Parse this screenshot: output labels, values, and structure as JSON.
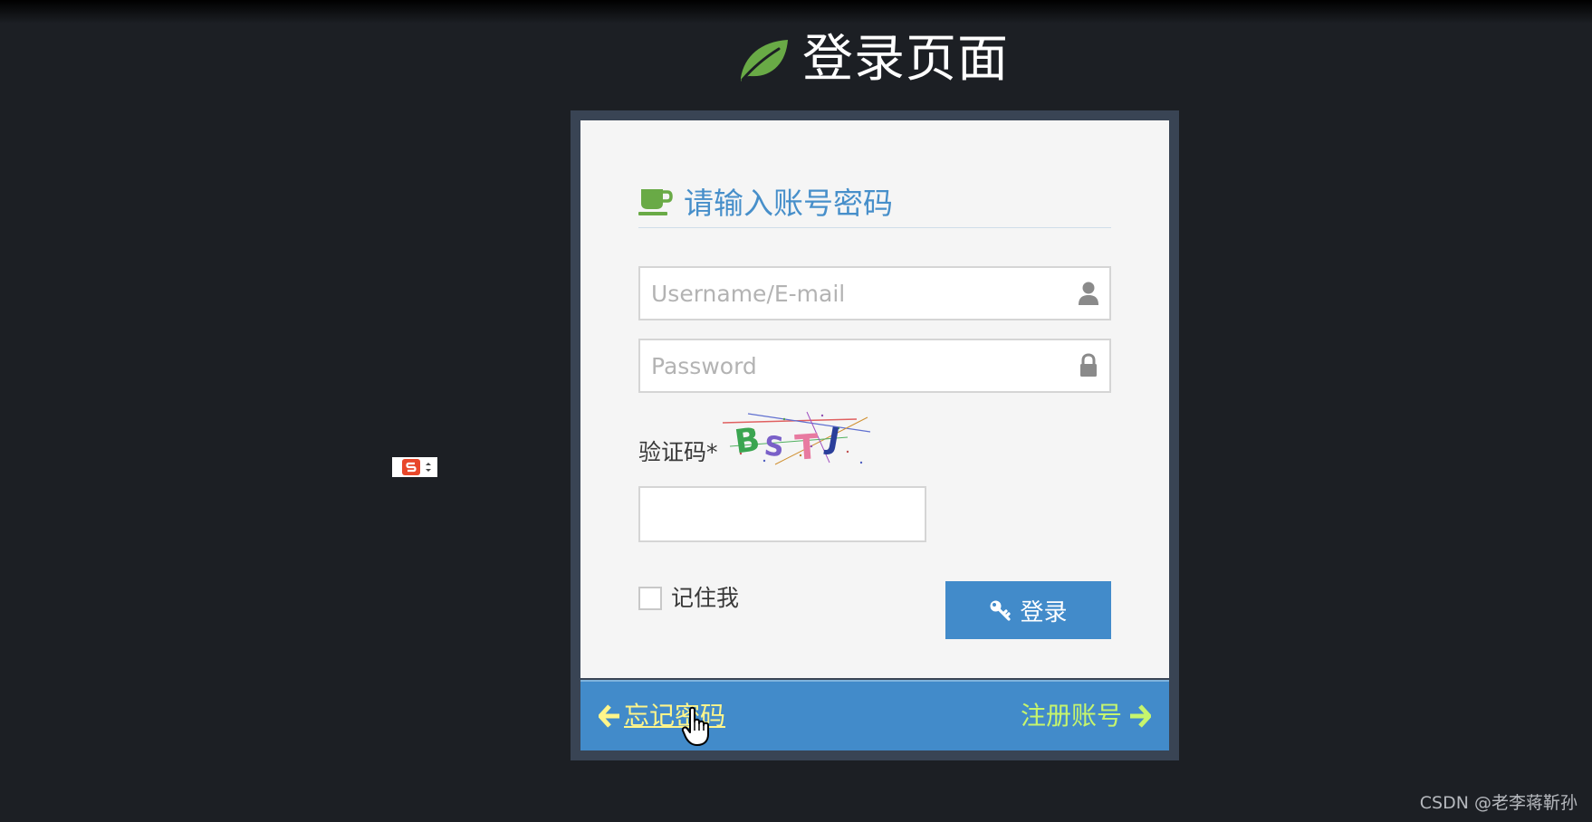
{
  "header": {
    "title": "登录页面",
    "icon": "leaf-icon"
  },
  "login_card": {
    "heading": "请输入账号密码",
    "heading_icon": "coffee-cup-icon",
    "username": {
      "placeholder": "Username/E-mail",
      "value": "",
      "icon": "user-icon"
    },
    "password": {
      "placeholder": "Password",
      "value": "",
      "icon": "lock-icon"
    },
    "captcha": {
      "label": "验证码*",
      "image_text": "BSTJ",
      "value": ""
    },
    "remember_me": {
      "label": "记住我",
      "checked": false
    },
    "login_button": {
      "label": "登录",
      "icon": "key-icon"
    }
  },
  "footer": {
    "forgot_password": "忘记密码",
    "register": "注册账号"
  },
  "watermark": "CSDN @老李蒋靳孙",
  "colors": {
    "background": "#1c1f24",
    "card_frame": "#394454",
    "accent_blue": "#428bca",
    "heading_blue": "#478fca",
    "leaf_green": "#69aa46",
    "forgot_link": "#fff58a",
    "register_link": "#c6f56d"
  }
}
